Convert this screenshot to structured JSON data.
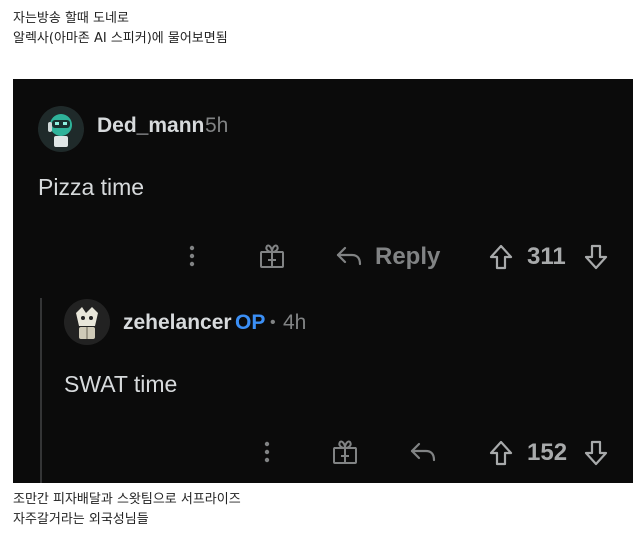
{
  "captions": {
    "top_line1": "자는방송 할때 도네로",
    "top_line2": "알렉사(아마존 AI 스피커)에 물어보면됨",
    "bottom_line1": "조만간 피자배달과 스왓팀으로 서프라이즈",
    "bottom_line2": "자주갈거라는 외국성님들"
  },
  "comments": [
    {
      "username": "Ded_mann",
      "time": "5h",
      "body": "Pizza time",
      "reply_label": "Reply",
      "votes": "311"
    },
    {
      "username": "zehelancer",
      "op_badge": "OP",
      "separator": "•",
      "time": "4h",
      "body": "SWAT time",
      "votes": "152"
    }
  ],
  "icons": {
    "more": "more-vertical-icon",
    "award": "gift-award-icon",
    "reply": "reply-arrow-icon",
    "upvote": "upvote-arrow-icon",
    "downvote": "downvote-arrow-icon"
  },
  "colors": {
    "background": "#0b0b0b",
    "text": "#d7dadc",
    "muted": "#818384",
    "op": "#3b8ff6"
  }
}
